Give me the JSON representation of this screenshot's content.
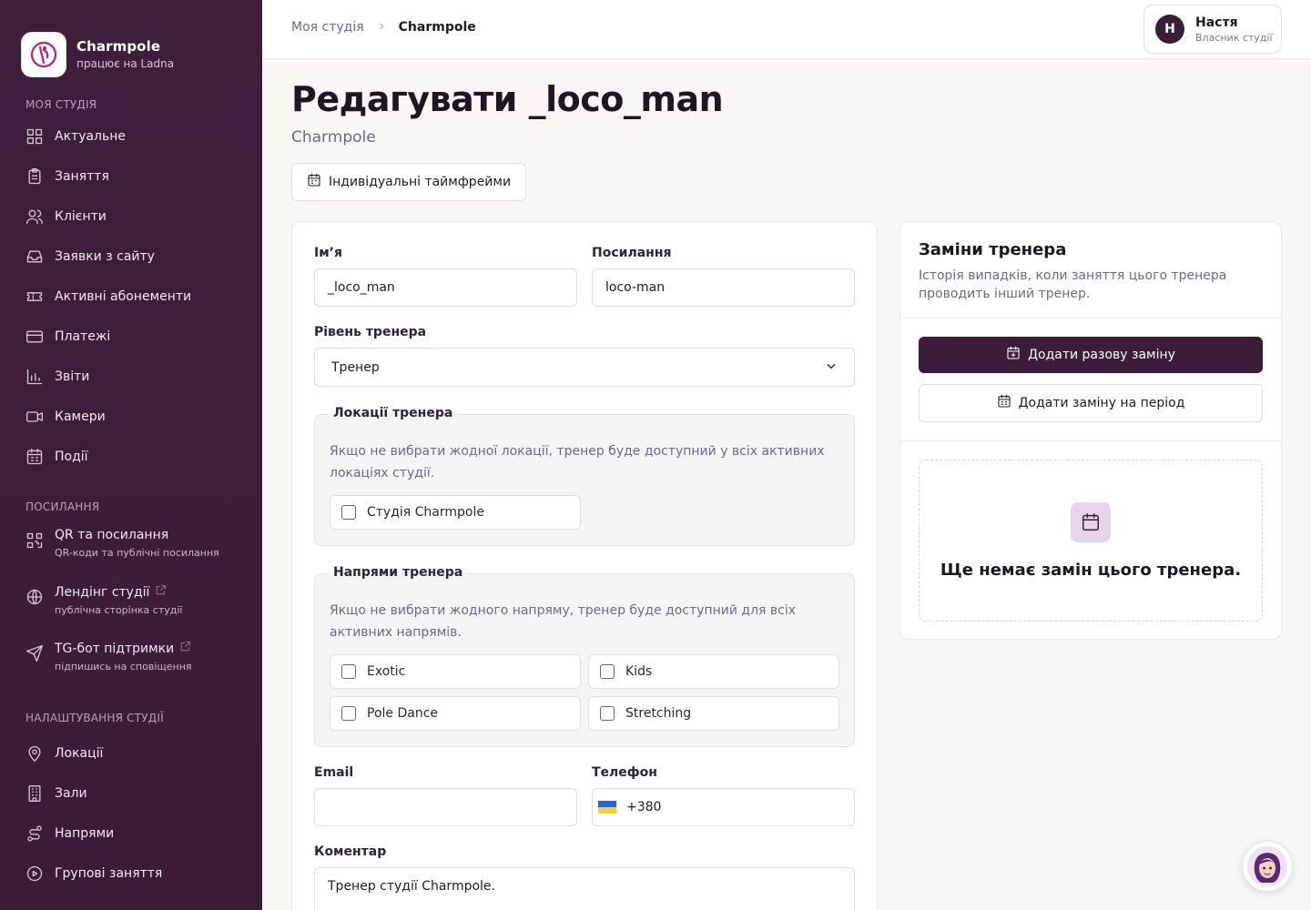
{
  "brand": {
    "name": "Charmpole",
    "subtitle": "працює на Ladna"
  },
  "sidebar": {
    "section_studio": "МОЯ СТУДІЯ",
    "studio_items": [
      {
        "label": "Актуальне",
        "icon": "dashboard-icon"
      },
      {
        "label": "Заняття",
        "icon": "clipboard-icon"
      },
      {
        "label": "Клієнти",
        "icon": "users-icon"
      },
      {
        "label": "Заявки з сайту",
        "icon": "inbox-icon"
      },
      {
        "label": "Активні абонементи",
        "icon": "ticket-icon"
      },
      {
        "label": "Платежі",
        "icon": "credit-card-icon"
      },
      {
        "label": "Звіти",
        "icon": "bar-chart-icon"
      },
      {
        "label": "Камери",
        "icon": "video-icon"
      },
      {
        "label": "Події",
        "icon": "calendar-icon"
      }
    ],
    "section_links": "ПОСИЛАННЯ",
    "link_items": [
      {
        "label": "QR та посилання",
        "sub": "QR-коди та публічні посилання",
        "icon": "qr-icon"
      },
      {
        "label": "Лендінг студії",
        "sub": "публічна сторінка студії",
        "icon": "globe-icon"
      },
      {
        "label": "TG-бот підтримки",
        "sub": "підпишись на сповіщення",
        "icon": "send-icon"
      }
    ],
    "section_settings": "НАЛАШТУВАННЯ СТУДІЇ",
    "settings_items": [
      {
        "label": "Локації",
        "icon": "map-pin-icon"
      },
      {
        "label": "Зали",
        "icon": "building-icon"
      },
      {
        "label": "Напрями",
        "icon": "route-icon"
      },
      {
        "label": "Групові заняття",
        "icon": "circle-play-icon"
      }
    ]
  },
  "breadcrumb": {
    "parent": "Моя студія",
    "current": "Charmpole"
  },
  "user": {
    "initial": "Н",
    "name": "Настя",
    "role": "Власник студії"
  },
  "page": {
    "title": "Редагувати _loco_man",
    "subtitle": "Charmpole",
    "timeframes_button": "Індивідуальні таймфрейми"
  },
  "form": {
    "name_label": "Ім’я",
    "name_value": "_loco_man",
    "slug_label": "Посилання",
    "slug_value": "loco-man",
    "level_label": "Рівень тренера",
    "level_value": "Тренер",
    "locations": {
      "legend": "Локації тренера",
      "hint": "Якщо не вибрати жодної локації, тренер буде доступний у всіх активних локаціях студії.",
      "options": [
        "Студія Charmpole"
      ]
    },
    "directions": {
      "legend": "Напрями тренера",
      "hint": "Якщо не вибрати жодного напряму, тренер буде доступний для всіх активних напрямів.",
      "options": [
        "Exotic",
        "Kids",
        "Pole Dance",
        "Stretching"
      ]
    },
    "email_label": "Email",
    "email_value": "",
    "phone_label": "Телефон",
    "phone_value": "+380",
    "comment_label": "Коментар",
    "comment_value": "Тренер студії Charmpole."
  },
  "substitutions": {
    "title": "Заміни тренера",
    "description": "Історія випадків, коли заняття цього тренера проводить інший тренер.",
    "add_single": "Додати разову заміну",
    "add_period": "Додати заміну на період",
    "empty_text": "Ще немає замін цього тренера."
  },
  "colors": {
    "sidebar_bg": "#3b1d3a",
    "primary": "#3b1d3a",
    "empty_icon_bg": "#e6d4ec"
  }
}
